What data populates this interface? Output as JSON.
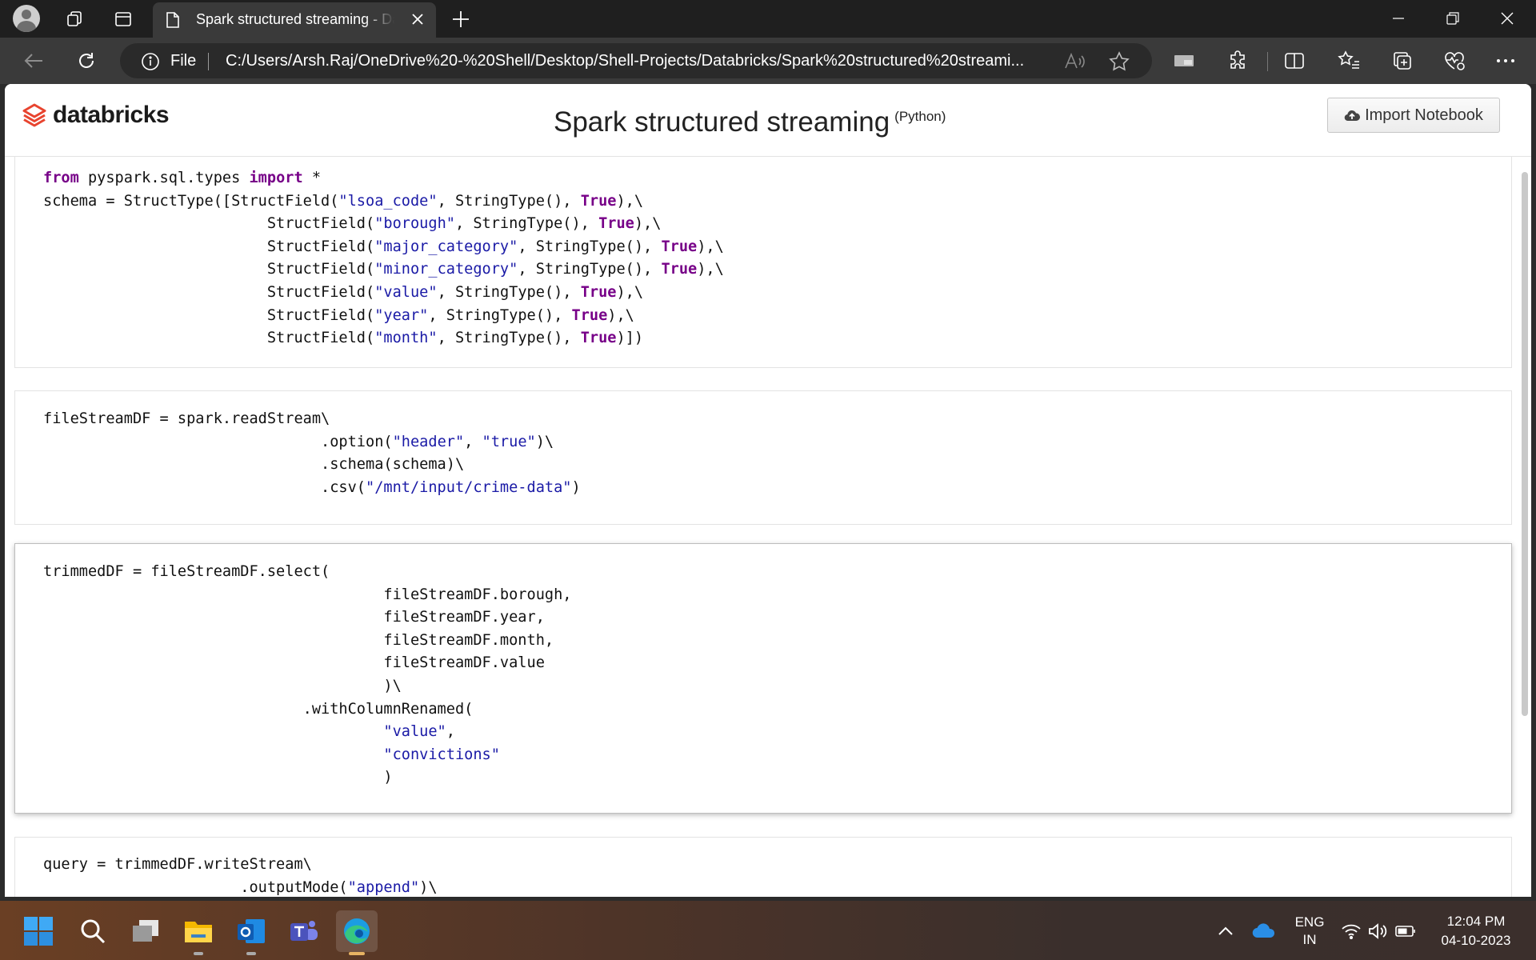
{
  "browser": {
    "tab_title": "Spark structured streaming - Databricks",
    "address_scheme": "File",
    "url": "C:/Users/Arsh.Raj/OneDrive%20-%20Shell/Desktop/Shell-Projects/Databricks/Spark%20structured%20streami..."
  },
  "notebook": {
    "brand": "databricks",
    "title": "Spark structured streaming",
    "language": "(Python)",
    "import_label": "Import Notebook"
  },
  "cells": [
    {
      "lines": [
        [
          [
            "kw",
            "from"
          ],
          [
            "t",
            " pyspark.sql.types "
          ],
          [
            "kw",
            "import"
          ],
          [
            "t",
            " *"
          ]
        ],
        [
          [
            "t",
            "schema = StructType([StructField("
          ],
          [
            "str",
            "\"lsoa_code\""
          ],
          [
            "t",
            ", StringType(), "
          ],
          [
            "kw",
            "True"
          ],
          [
            "t",
            "),\\"
          ]
        ],
        [
          [
            "t",
            "                         StructField("
          ],
          [
            "str",
            "\"borough\""
          ],
          [
            "t",
            ", StringType(), "
          ],
          [
            "kw",
            "True"
          ],
          [
            "t",
            "),\\"
          ]
        ],
        [
          [
            "t",
            "                         StructField("
          ],
          [
            "str",
            "\"major_category\""
          ],
          [
            "t",
            ", StringType(), "
          ],
          [
            "kw",
            "True"
          ],
          [
            "t",
            "),\\"
          ]
        ],
        [
          [
            "t",
            "                         StructField("
          ],
          [
            "str",
            "\"minor_category\""
          ],
          [
            "t",
            ", StringType(), "
          ],
          [
            "kw",
            "True"
          ],
          [
            "t",
            "),\\"
          ]
        ],
        [
          [
            "t",
            "                         StructField("
          ],
          [
            "str",
            "\"value\""
          ],
          [
            "t",
            ", StringType(), "
          ],
          [
            "kw",
            "True"
          ],
          [
            "t",
            "),\\"
          ]
        ],
        [
          [
            "t",
            "                         StructField("
          ],
          [
            "str",
            "\"year\""
          ],
          [
            "t",
            ", StringType(), "
          ],
          [
            "kw",
            "True"
          ],
          [
            "t",
            "),\\"
          ]
        ],
        [
          [
            "t",
            "                         StructField("
          ],
          [
            "str",
            "\"month\""
          ],
          [
            "t",
            ", StringType(), "
          ],
          [
            "kw",
            "True"
          ],
          [
            "t",
            ")])"
          ]
        ]
      ]
    },
    {
      "lines": [
        [
          [
            "t",
            "fileStreamDF = spark.readStream\\"
          ]
        ],
        [
          [
            "t",
            "                               .option("
          ],
          [
            "str",
            "\"header\""
          ],
          [
            "t",
            ", "
          ],
          [
            "str",
            "\"true\""
          ],
          [
            "t",
            ")\\"
          ]
        ],
        [
          [
            "t",
            "                               .schema(schema)\\"
          ]
        ],
        [
          [
            "t",
            "                               .csv("
          ],
          [
            "str",
            "\"/mnt/input/crime-data\""
          ],
          [
            "t",
            ")"
          ]
        ]
      ]
    },
    {
      "lines": [
        [
          [
            "t",
            "trimmedDF = fileStreamDF.select("
          ]
        ],
        [
          [
            "t",
            "                                      fileStreamDF.borough,"
          ]
        ],
        [
          [
            "t",
            "                                      fileStreamDF.year,"
          ]
        ],
        [
          [
            "t",
            "                                      fileStreamDF.month,"
          ]
        ],
        [
          [
            "t",
            "                                      fileStreamDF.value"
          ]
        ],
        [
          [
            "t",
            "                                      )\\"
          ]
        ],
        [
          [
            "t",
            "                             .withColumnRenamed("
          ]
        ],
        [
          [
            "t",
            "                                      "
          ],
          [
            "str",
            "\"value\""
          ],
          [
            "t",
            ","
          ]
        ],
        [
          [
            "t",
            "                                      "
          ],
          [
            "str",
            "\"convictions\""
          ]
        ],
        [
          [
            "t",
            "                                      )"
          ]
        ]
      ]
    },
    {
      "lines": [
        [
          [
            "t",
            "query = trimmedDF.writeStream\\"
          ]
        ],
        [
          [
            "t",
            "                      .outputMode("
          ],
          [
            "str",
            "\"append\""
          ],
          [
            "t",
            ")\\"
          ]
        ]
      ]
    }
  ],
  "taskbar": {
    "lang_line1": "ENG",
    "lang_line2": "IN",
    "time": "12:04 PM",
    "date": "04-10-2023"
  },
  "colors": {
    "keyword": "#770088",
    "string": "#1a1aa6",
    "brand_red": "#e8442f"
  }
}
